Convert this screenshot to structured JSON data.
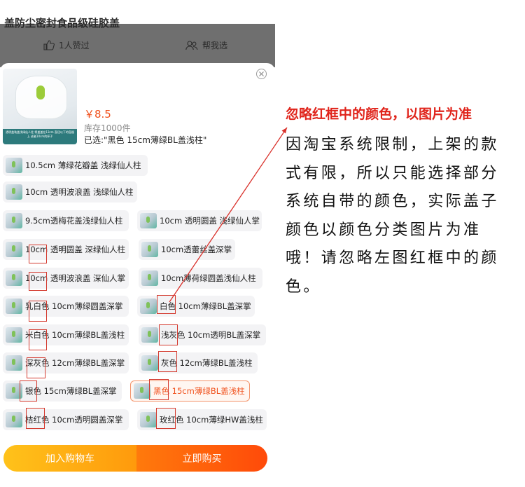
{
  "background": {
    "title": "盖防尘密封食品级硅胶盖",
    "like_label": "1人赞过",
    "help_label": "帮我选"
  },
  "product": {
    "thumbnail_caption": "透明盖装盖浅绿仙人柱 将盖盖在13cm 直径以下的容器上 或者10cm的杯子",
    "price": "￥8.5",
    "stock": "库存1000件",
    "selected": "已选:\"黑色 15cm薄绿BL盖浅柱\""
  },
  "options": [
    {
      "label": "10.5cm 薄绿花瓣盖  浅绿仙人柱",
      "selected": false
    },
    {
      "label": "10cm 透明波浪盖 浅绿仙人柱",
      "selected": false
    },
    {
      "label": "9.5cm透梅花盖浅绿仙人柱",
      "selected": false
    },
    {
      "label": "10cm 透明圆盖 浅绿仙人掌",
      "selected": false
    },
    {
      "label": "10cm 透明圆盖 深绿仙人柱",
      "selected": false
    },
    {
      "label": "10cm透蕾丝盖深掌",
      "selected": false
    },
    {
      "label": "10cm 透明波浪盖  深仙人掌",
      "selected": false
    },
    {
      "label": "10cm薄荷绿圆盖浅仙人柱",
      "selected": false
    },
    {
      "label": "乳白色 10cm薄绿圆盖深掌",
      "selected": false
    },
    {
      "label": "白色 10cm薄绿BL盖深掌",
      "selected": false
    },
    {
      "label": "米白色 10cm薄绿BL盖浅柱",
      "selected": false
    },
    {
      "label": "浅灰色 10cm透明BL盖深掌",
      "selected": false
    },
    {
      "label": "深灰色 12cm薄绿BL盖深掌",
      "selected": false
    },
    {
      "label": "灰色 12cm薄绿BL盖浅柱",
      "selected": false
    },
    {
      "label": "银色 15cm薄绿BL盖深掌",
      "selected": false
    },
    {
      "label": "黑色 15cm薄绿BL盖浅柱",
      "selected": true
    },
    {
      "label": "桔红色 10cm透明圆盖深掌",
      "selected": false
    },
    {
      "label": "玫红色 10cm薄绿HW盖浅柱",
      "selected": false
    }
  ],
  "actions": {
    "add_to_cart": "加入购物车",
    "buy_now": "立即购买"
  },
  "note": {
    "heading": "忽略红框中的颜色，以图片为准",
    "body": "因淘宝系统限制，上架的款式有限，所以只能选择部分系统自带的颜色，实际盖子颜色以颜色分类图片为准哦！请忽略左图红框中的颜色。"
  },
  "colors": {
    "accent": "#f04f1a",
    "annotation_red": "#e0241b",
    "cart_button": "#ffb314",
    "buy_button": "#ff5a0a"
  }
}
